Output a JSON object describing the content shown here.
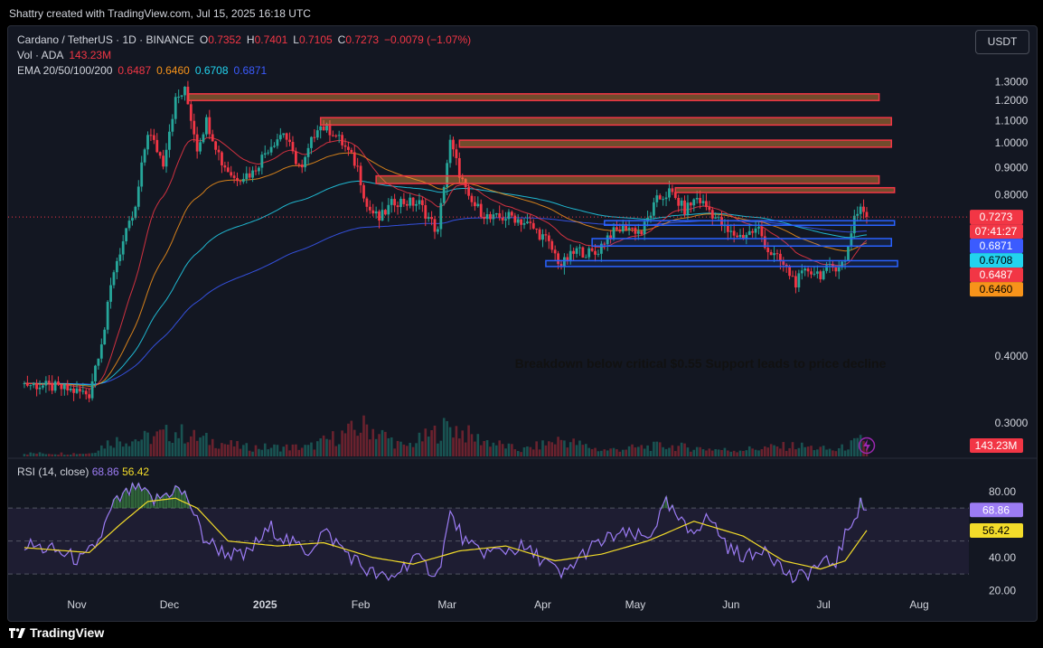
{
  "header": {
    "credit": "Shattry created with TradingView.com, Jul 15, 2025 16:18 UTC"
  },
  "legend": {
    "symbol": "Cardano / TetherUS · 1D · BINANCE",
    "o_label": "O",
    "o": "0.7352",
    "h_label": "H",
    "h": "0.7401",
    "l_label": "L",
    "l": "0.7105",
    "c_label": "C",
    "c": "0.7273",
    "change": "−0.0079 (−1.07%)",
    "vol_label": "Vol · ADA",
    "vol": "143.23M",
    "ema_label": "EMA 20/50/100/200",
    "ema20": "0.6487",
    "ema50": "0.6460",
    "ema100": "0.6708",
    "ema200": "0.6871"
  },
  "currency_button": "USDT",
  "rsi_legend": {
    "label": "RSI (14, close)",
    "rsi": "68.86",
    "ma": "56.42"
  },
  "footer": {
    "brand": "TradingView"
  },
  "colors": {
    "up": "#26a69a",
    "down": "#f23645",
    "ema20": "#f23645",
    "ema50": "#f7931a",
    "ema100": "#22d3ee",
    "ema200": "#3b5bff",
    "rsi": "#9c7cf4",
    "rsi_ma": "#f3dc2a",
    "resistance": "#f23645",
    "support": "#2962ff"
  },
  "chart_data": [
    {
      "type": "candlestick",
      "title": "Cardano / TetherUS · 1D · BINANCE",
      "x_ticks": [
        "Nov",
        "Dec",
        "2025",
        "Feb",
        "Mar",
        "Apr",
        "May",
        "Jun",
        "Jul",
        "Aug"
      ],
      "y_ticks": [
        "1.3000",
        "1.2000",
        "1.1000",
        "1.0000",
        "0.9000",
        "0.8000",
        "0.4000",
        "0.3000"
      ],
      "ylim": [
        0.26,
        1.36
      ],
      "log_scale": true,
      "grid": false,
      "last_price": "0.7273",
      "countdown": "07:41:27",
      "price_path": [
        [
          "2024-10-15",
          0.355
        ],
        [
          "2024-10-25",
          0.35
        ],
        [
          "2024-11-05",
          0.34
        ],
        [
          "2024-11-10",
          0.45
        ],
        [
          "2024-11-13",
          0.58
        ],
        [
          "2024-11-20",
          0.75
        ],
        [
          "2024-11-24",
          1.05
        ],
        [
          "2024-11-29",
          0.92
        ],
        [
          "2024-12-03",
          1.2
        ],
        [
          "2024-12-06",
          1.25
        ],
        [
          "2024-12-10",
          0.98
        ],
        [
          "2024-12-13",
          1.1
        ],
        [
          "2024-12-18",
          0.92
        ],
        [
          "2024-12-22",
          0.86
        ],
        [
          "2024-12-28",
          0.88
        ],
        [
          "2025-01-02",
          0.98
        ],
        [
          "2025-01-07",
          1.05
        ],
        [
          "2025-01-10",
          0.95
        ],
        [
          "2025-01-13",
          0.89
        ],
        [
          "2025-01-18",
          1.08
        ],
        [
          "2025-01-23",
          1.05
        ],
        [
          "2025-01-27",
          0.98
        ],
        [
          "2025-01-31",
          0.9
        ],
        [
          "2025-02-03",
          0.76
        ],
        [
          "2025-02-07",
          0.72
        ],
        [
          "2025-02-12",
          0.78
        ],
        [
          "2025-02-20",
          0.77
        ],
        [
          "2025-02-26",
          0.68
        ],
        [
          "2025-03-02",
          1.0
        ],
        [
          "2025-03-05",
          0.88
        ],
        [
          "2025-03-08",
          0.78
        ],
        [
          "2025-03-15",
          0.72
        ],
        [
          "2025-03-22",
          0.73
        ],
        [
          "2025-03-28",
          0.7
        ],
        [
          "2025-04-02",
          0.66
        ],
        [
          "2025-04-07",
          0.59
        ],
        [
          "2025-04-12",
          0.63
        ],
        [
          "2025-04-18",
          0.62
        ],
        [
          "2025-04-22",
          0.67
        ],
        [
          "2025-04-28",
          0.7
        ],
        [
          "2025-05-03",
          0.68
        ],
        [
          "2025-05-08",
          0.78
        ],
        [
          "2025-05-12",
          0.81
        ],
        [
          "2025-05-17",
          0.75
        ],
        [
          "2025-05-21",
          0.79
        ],
        [
          "2025-05-25",
          0.75
        ],
        [
          "2025-05-31",
          0.68
        ],
        [
          "2025-06-04",
          0.67
        ],
        [
          "2025-06-10",
          0.69
        ],
        [
          "2025-06-13",
          0.63
        ],
        [
          "2025-06-17",
          0.6
        ],
        [
          "2025-06-22",
          0.55
        ],
        [
          "2025-06-26",
          0.58
        ],
        [
          "2025-06-30",
          0.57
        ],
        [
          "2025-07-05",
          0.59
        ],
        [
          "2025-07-08",
          0.6
        ],
        [
          "2025-07-11",
          0.73
        ],
        [
          "2025-07-13",
          0.76
        ],
        [
          "2025-07-15",
          0.7273
        ]
      ],
      "emas": [
        {
          "name": "EMA 20",
          "last": "0.6487"
        },
        {
          "name": "EMA 50",
          "last": "0.6460"
        },
        {
          "name": "EMA 100",
          "last": "0.6708"
        },
        {
          "name": "EMA 200",
          "last": "0.6871"
        }
      ],
      "zones": [
        {
          "kind": "resistance",
          "start": "2024-12-07",
          "end": "2025-07-19",
          "low": 1.2,
          "high": 1.235
        },
        {
          "kind": "resistance",
          "start": "2025-01-19",
          "end": "2025-07-23",
          "low": 1.08,
          "high": 1.115
        },
        {
          "kind": "resistance",
          "start": "2025-03-05",
          "end": "2025-07-23",
          "low": 0.982,
          "high": 1.012
        },
        {
          "kind": "resistance",
          "start": "2025-02-06",
          "end": "2025-07-19",
          "low": 0.84,
          "high": 0.868
        },
        {
          "kind": "resistance",
          "start": "2025-05-14",
          "end": "2025-07-24",
          "low": 0.808,
          "high": 0.825
        },
        {
          "kind": "support",
          "start": "2025-04-21",
          "end": "2025-07-24",
          "low": 0.702,
          "high": 0.716
        },
        {
          "kind": "support",
          "start": "2025-04-17",
          "end": "2025-07-23",
          "low": 0.642,
          "high": 0.663
        },
        {
          "kind": "support",
          "start": "2025-04-02",
          "end": "2025-07-25",
          "low": 0.588,
          "high": 0.603
        }
      ],
      "annotation": "Breakdown below critical $0.55 Support leads to price decline"
    },
    {
      "type": "bar",
      "title": "Vol · ADA",
      "last": "143.23M",
      "volume_path": [
        [
          "2024-10-15",
          0.1
        ],
        [
          "2024-11-05",
          0.1
        ],
        [
          "2024-11-12",
          0.5
        ],
        [
          "2024-11-24",
          0.6
        ],
        [
          "2024-12-03",
          0.8
        ],
        [
          "2024-12-10",
          0.6
        ],
        [
          "2024-12-25",
          0.3
        ],
        [
          "2025-01-15",
          0.3
        ],
        [
          "2025-02-03",
          1.0
        ],
        [
          "2025-02-15",
          0.3
        ],
        [
          "2025-03-02",
          1.0
        ],
        [
          "2025-03-10",
          0.6
        ],
        [
          "2025-03-25",
          0.2
        ],
        [
          "2025-04-07",
          0.55
        ],
        [
          "2025-04-20",
          0.2
        ],
        [
          "2025-05-10",
          0.35
        ],
        [
          "2025-06-01",
          0.2
        ],
        [
          "2025-06-22",
          0.35
        ],
        [
          "2025-07-05",
          0.2
        ],
        [
          "2025-07-13",
          0.5
        ],
        [
          "2025-07-15",
          0.3
        ]
      ]
    },
    {
      "type": "line",
      "title": "RSI (14, close)",
      "y_ticks": [
        "80.00",
        "40.00",
        "20.00"
      ],
      "ylim": [
        18,
        86
      ],
      "bands": {
        "upper": 70,
        "middle": 50,
        "lower": 30
      },
      "series": [
        {
          "name": "RSI",
          "last": "68.86",
          "path": [
            [
              "2024-10-15",
              48
            ],
            [
              "2024-10-25",
              44
            ],
            [
              "2024-11-03",
              38
            ],
            [
              "2024-11-08",
              50
            ],
            [
              "2024-11-13",
              72
            ],
            [
              "2024-11-20",
              83
            ],
            [
              "2024-11-26",
              74
            ],
            [
              "2024-12-03",
              82
            ],
            [
              "2024-12-07",
              76
            ],
            [
              "2024-12-12",
              52
            ],
            [
              "2024-12-18",
              44
            ],
            [
              "2024-12-25",
              40
            ],
            [
              "2025-01-03",
              58
            ],
            [
              "2025-01-10",
              48
            ],
            [
              "2025-01-15",
              44
            ],
            [
              "2025-01-20",
              56
            ],
            [
              "2025-01-27",
              44
            ],
            [
              "2025-02-03",
              32
            ],
            [
              "2025-02-10",
              26
            ],
            [
              "2025-02-18",
              40
            ],
            [
              "2025-02-26",
              30
            ],
            [
              "2025-03-02",
              66
            ],
            [
              "2025-03-08",
              46
            ],
            [
              "2025-03-15",
              43
            ],
            [
              "2025-03-25",
              46
            ],
            [
              "2025-04-02",
              38
            ],
            [
              "2025-04-07",
              28
            ],
            [
              "2025-04-15",
              44
            ],
            [
              "2025-04-25",
              54
            ],
            [
              "2025-05-05",
              52
            ],
            [
              "2025-05-11",
              72
            ],
            [
              "2025-05-18",
              56
            ],
            [
              "2025-05-25",
              64
            ],
            [
              "2025-06-01",
              44
            ],
            [
              "2025-06-08",
              40
            ],
            [
              "2025-06-12",
              48
            ],
            [
              "2025-06-18",
              32
            ],
            [
              "2025-06-22",
              26
            ],
            [
              "2025-06-28",
              34
            ],
            [
              "2025-07-05",
              38
            ],
            [
              "2025-07-10",
              62
            ],
            [
              "2025-07-13",
              72
            ],
            [
              "2025-07-15",
              68.86
            ]
          ]
        },
        {
          "name": "RSI-based MA",
          "last": "56.42",
          "path": [
            [
              "2024-10-15",
              46
            ],
            [
              "2024-11-05",
              43
            ],
            [
              "2024-11-15",
              60
            ],
            [
              "2024-11-24",
              74
            ],
            [
              "2024-12-03",
              76
            ],
            [
              "2024-12-10",
              70
            ],
            [
              "2024-12-20",
              50
            ],
            [
              "2025-01-05",
              47
            ],
            [
              "2025-01-20",
              49
            ],
            [
              "2025-02-05",
              40
            ],
            [
              "2025-02-18",
              36
            ],
            [
              "2025-03-05",
              44
            ],
            [
              "2025-03-20",
              47
            ],
            [
              "2025-04-05",
              38
            ],
            [
              "2025-04-20",
              42
            ],
            [
              "2025-05-05",
              50
            ],
            [
              "2025-05-20",
              62
            ],
            [
              "2025-06-05",
              53
            ],
            [
              "2025-06-18",
              38
            ],
            [
              "2025-06-30",
              33
            ],
            [
              "2025-07-08",
              38
            ],
            [
              "2025-07-15",
              56.42
            ]
          ]
        }
      ]
    }
  ]
}
